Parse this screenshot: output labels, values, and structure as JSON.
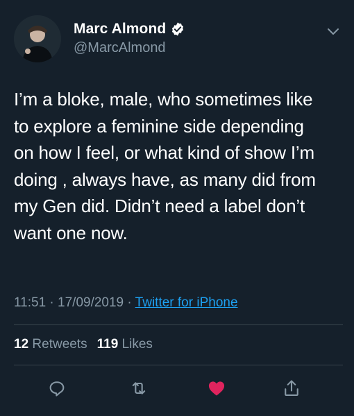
{
  "user": {
    "name": "Marc Almond",
    "handle": "@MarcAlmond",
    "verified": true
  },
  "tweet": {
    "text": "I’m a  bloke, male,  who sometimes like\nto explore a feminine side depending\non how I feel, or what kind of show I’m\ndoing , always have,  as many did from\nmy Gen did. Didn’t need a label  don’t\nwant one now."
  },
  "meta": {
    "time": "11:51",
    "separator": " · ",
    "date": "17/09/2019",
    "source": "Twitter for iPhone"
  },
  "stats": {
    "retweets": "12",
    "retweets_label": "Retweets",
    "likes": "119",
    "likes_label": "Likes"
  },
  "icons": {
    "verified": "verified-badge-icon",
    "more": "chevron-down-icon",
    "reply": "reply-icon",
    "retweet": "retweet-icon",
    "like": "heart-icon",
    "share": "share-icon"
  },
  "colors": {
    "background": "#15202b",
    "text": "#ffffff",
    "secondary": "#8899a6",
    "link": "#1da1f2",
    "like": "#e0245e",
    "divider": "#38444d"
  }
}
